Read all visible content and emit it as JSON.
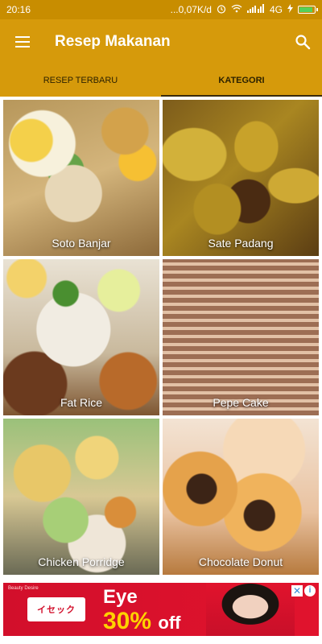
{
  "status_bar": {
    "time": "20:16",
    "network_speed": "...0,07K/d",
    "network_type": "4G",
    "icons": [
      "alarm-icon",
      "wifi-icon",
      "signal-icon",
      "charging-icon",
      "battery-icon"
    ]
  },
  "app_bar": {
    "title": "Resep Makanan",
    "menu_icon": "hamburger-menu-icon",
    "search_icon": "search-icon"
  },
  "tabs": [
    {
      "label": "RESEP TERBARU",
      "active": false
    },
    {
      "label": "KATEGORI",
      "active": true
    }
  ],
  "categories": [
    {
      "label": "Soto Banjar"
    },
    {
      "label": "Sate Padang"
    },
    {
      "label": "Fat Rice"
    },
    {
      "label": "Pepe Cake"
    },
    {
      "label": "Chicken Porridge"
    },
    {
      "label": "Chocolate Donut"
    }
  ],
  "ad": {
    "brand": "Beauty Desire",
    "logo_text": "イセック",
    "headline": "Eye",
    "offer_value": "30%",
    "offer_word": "off"
  },
  "colors": {
    "status_bar": "#c88d00",
    "app_bar": "#d69a0b",
    "ad_background": "#d20f2b",
    "ad_offer": "#ffd200"
  }
}
